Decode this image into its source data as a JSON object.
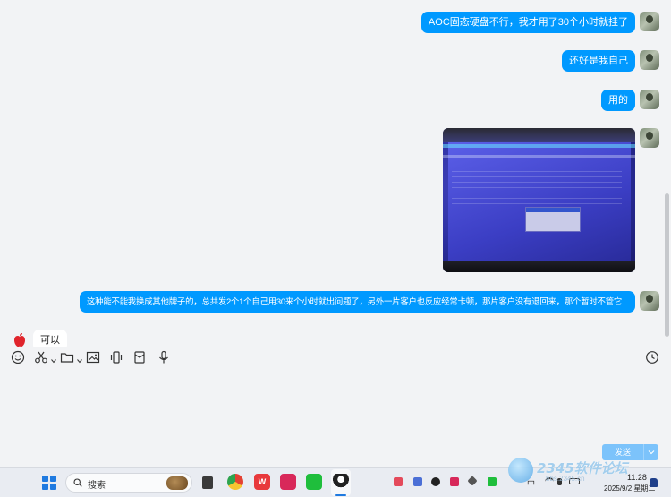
{
  "chat": {
    "messages": [
      {
        "direction": "out",
        "text": "AOC固态硬盘不行，我才用了30个小时就挂了"
      },
      {
        "direction": "out",
        "text": "还好是我自己"
      },
      {
        "direction": "out",
        "text": "用的"
      },
      {
        "direction": "out",
        "type": "image",
        "icon": "screenshot-photo"
      },
      {
        "direction": "out",
        "text": "这种能不能我换成其他牌子的，总共发2个1个自己用30来个小时就出问题了，另外一片客户也反应经常卡顿，那片客户没有退回来，那个暂时不管它"
      },
      {
        "direction": "in",
        "text": "可以"
      }
    ]
  },
  "toolbar": {
    "icons": [
      "emoji-icon",
      "scissors-icon",
      "folder-icon",
      "image-icon",
      "vibrate-icon",
      "red-packet-icon",
      "microphone-icon",
      "history-icon"
    ]
  },
  "composer": {
    "send_label": "发送"
  },
  "taskbar": {
    "search_placeholder": "搜索",
    "ime_label": "中",
    "time": "11:28",
    "date": "2025/9/2 星期二"
  },
  "watermark": {
    "brand": "2345软件论坛",
    "url": "bbs.2345.cn"
  },
  "colors": {
    "bubble_out": "#0099ff",
    "bubble_in": "#ffffff",
    "background": "#f2f3f5"
  }
}
